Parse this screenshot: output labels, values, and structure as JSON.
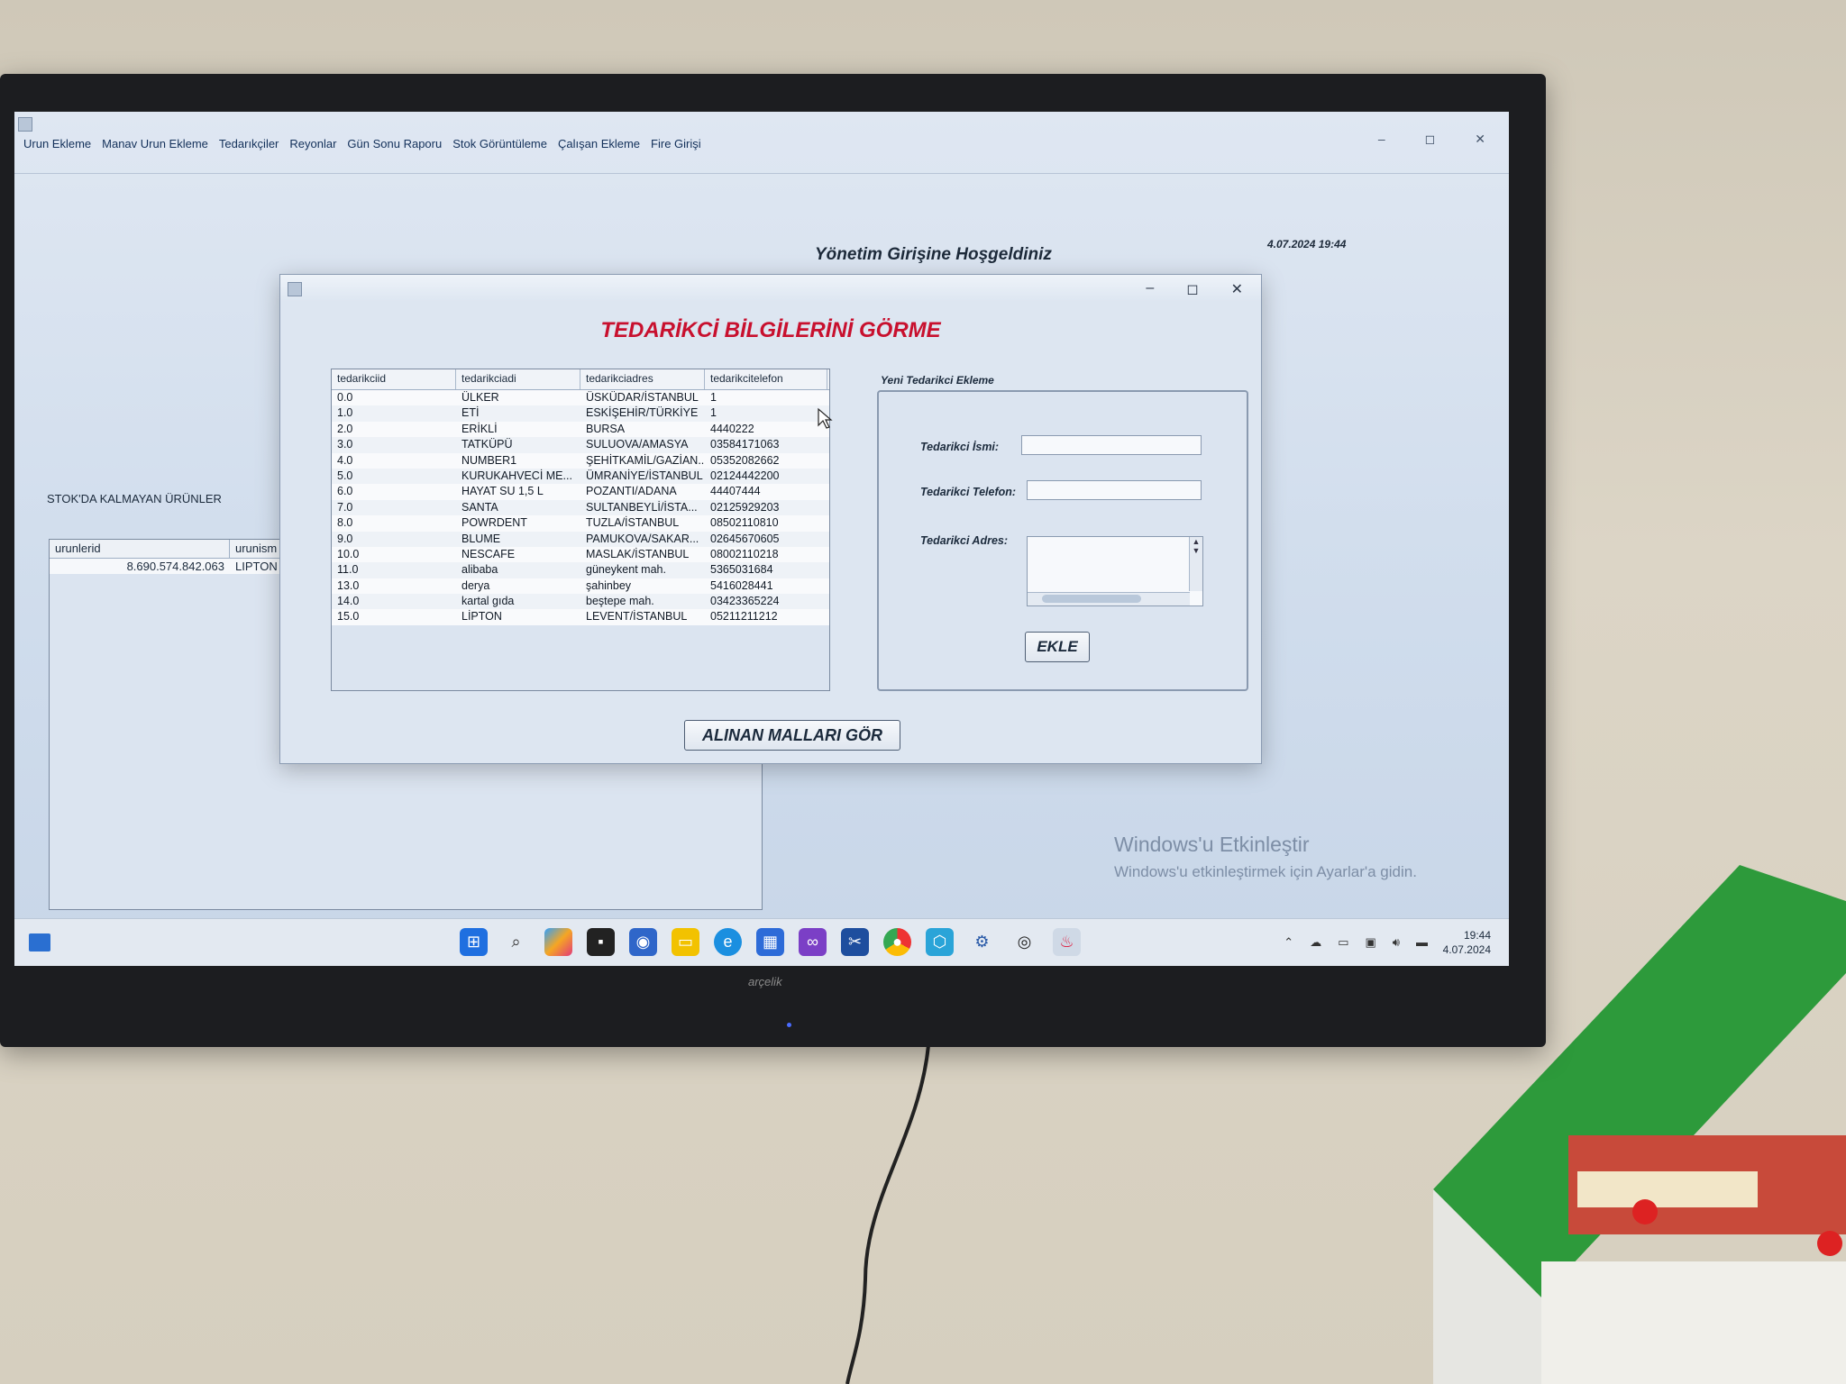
{
  "tv": {
    "brand": "arçelik"
  },
  "app": {
    "menu": [
      "Urun Ekleme",
      "Manav Urun Ekleme",
      "Tedarıkçiler",
      "Reyonlar",
      "Gün Sonu Raporu",
      "Stok Görüntüleme",
      "Çalışan Ekleme",
      "Fire Girişi"
    ],
    "welcome": "Yönetim Girişine Hoşgeldiniz",
    "datetime": "4.07.2024 19:44",
    "stock": {
      "title": "STOK'DA KALMAYAN ÜRÜNLER",
      "columns": [
        "urunlerid",
        "urunism"
      ],
      "rows": [
        [
          "8.690.574.842.063",
          "LIPTON"
        ]
      ]
    },
    "window_controls": {
      "minimize": "–",
      "maximize": "◻",
      "close": "✕"
    }
  },
  "dialog": {
    "heading": "TEDARİKCİ BİLGİLERİNİ GÖRME",
    "table": {
      "columns": [
        "tedarikciid",
        "tedarikciadi",
        "tedarikciadres",
        "tedarikcitelefon"
      ],
      "rows": [
        [
          "0.0",
          "ÜLKER",
          "ÜSKÜDAR/İSTANBUL",
          "1"
        ],
        [
          "1.0",
          "ETİ",
          "ESKİŞEHİR/TÜRKİYE",
          "1"
        ],
        [
          "2.0",
          "ERİKLİ",
          "BURSA",
          "4440222"
        ],
        [
          "3.0",
          "TATKÜPÜ",
          "SULUOVA/AMASYA",
          "03584171063"
        ],
        [
          "4.0",
          "NUMBER1",
          "ŞEHİTKAMİL/GAZİAN...",
          "05352082662"
        ],
        [
          "5.0",
          "KURUKAHVECİ ME...",
          "ÜMRANİYE/İSTANBUL",
          "02124442200"
        ],
        [
          "6.0",
          "HAYAT SU 1,5 L",
          "POZANTI/ADANA",
          "44407444"
        ],
        [
          "7.0",
          "SANTA",
          "SULTANBEYLİ/İSTA...",
          "02125929203"
        ],
        [
          "8.0",
          "POWRDENT",
          "TUZLA/İSTANBUL",
          "08502110810"
        ],
        [
          "9.0",
          "BLUME",
          "PAMUKOVA/SAKAR...",
          "02645670605"
        ],
        [
          "10.0",
          "NESCAFE",
          "MASLAK/İSTANBUL",
          "08002110218"
        ],
        [
          "11.0",
          "alibaba",
          "güneykent mah.",
          "5365031684"
        ],
        [
          "13.0",
          "derya",
          "şahinbey",
          "5416028441"
        ],
        [
          "14.0",
          "kartal gıda",
          "beştepe mah.",
          "03423365224"
        ],
        [
          "15.0",
          "LİPTON",
          "LEVENT/İSTANBUL",
          "05211211212"
        ]
      ]
    },
    "form": {
      "title": "Yeni Tedarikci Ekleme",
      "name_label": "Tedarikci İsmi:",
      "phone_label": "Tedarikci Telefon:",
      "address_label": "Tedarikci Adres:",
      "add_button": "EKLE"
    },
    "view_goods_button": "ALINAN MALLARI GÖR"
  },
  "watermark": {
    "title": "Windows'u Etkinleştir",
    "subtitle": "Windows'u etkinleştirmek için Ayarlar'a gidin."
  },
  "taskbar": {
    "icons": [
      "start-icon",
      "search-icon",
      "copilot-icon",
      "task-view-icon",
      "meet-icon",
      "file-explorer-icon",
      "edge-icon",
      "store-icon",
      "visual-studio-icon",
      "snipping-tool-icon",
      "chrome-icon",
      "app-icon",
      "settings-icon",
      "media-icon",
      "java-icon"
    ],
    "time": "19:44",
    "date": "4.07.2024"
  },
  "colors": {
    "heading": "#c8102e",
    "screen_bg": "#d8e2ee"
  }
}
